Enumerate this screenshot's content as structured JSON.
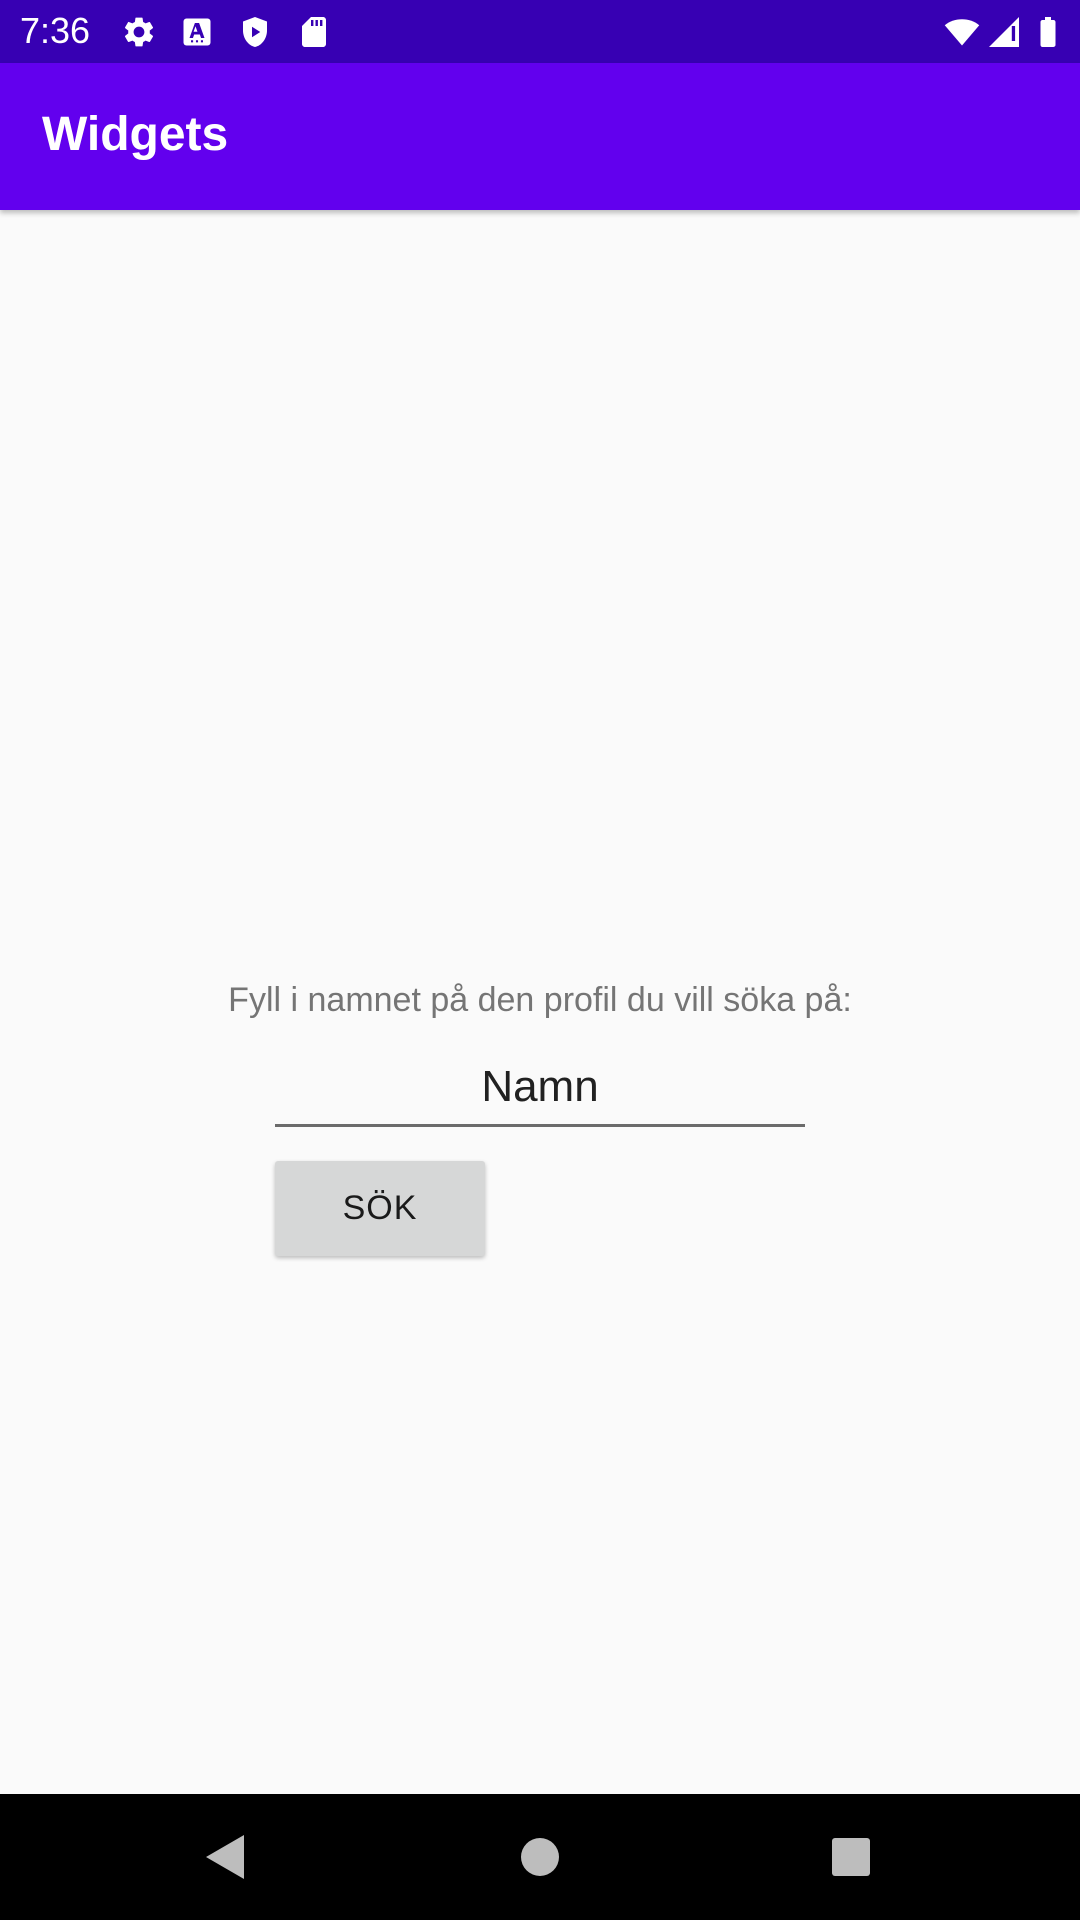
{
  "status_bar": {
    "time": "7:36",
    "icons": [
      "gear-icon",
      "font-a-icon",
      "shield-play-icon",
      "sd-card-icon",
      "wifi-icon",
      "signal-icon",
      "battery-icon"
    ]
  },
  "app_bar": {
    "title": "Widgets"
  },
  "main": {
    "prompt": "Fyll i namnet på den profil du vill söka på:",
    "name_field": {
      "value": "",
      "placeholder": "Namn"
    },
    "search_button_label": "SÖK"
  },
  "nav_bar": {
    "icons": [
      "back-icon",
      "home-icon",
      "recents-icon"
    ]
  },
  "colors": {
    "status_bar": "#3700b3",
    "app_bar": "#6200ee",
    "background": "#fafafa",
    "button": "#d6d7d7"
  }
}
